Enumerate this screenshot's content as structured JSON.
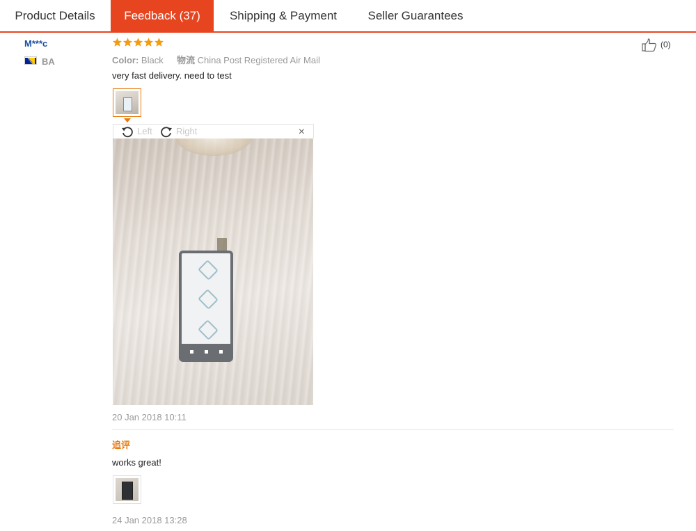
{
  "tabs": [
    {
      "label": "Product Details",
      "active": false
    },
    {
      "label": "Feedback (37)",
      "active": true
    },
    {
      "label": "Shipping & Payment",
      "active": false
    },
    {
      "label": "Seller Guarantees",
      "active": false
    }
  ],
  "accent_color": "#e64520",
  "review": {
    "buyer_name": "M***c",
    "country_code": "BA",
    "rating_stars": 5,
    "color_key": "Color:",
    "color_value": "Black",
    "logistics_key": "物流",
    "logistics_value": "China Post Registered Air Mail",
    "text": "very fast delivery. need to test",
    "viewer": {
      "rotate_left_label": "Left",
      "rotate_right_label": "Right",
      "close_label": "×"
    },
    "date": "20 Jan 2018 10:11",
    "helpful_count": "(0)"
  },
  "additional_feedback": {
    "title": "追评",
    "text": "works great!",
    "date": "24 Jan 2018 13:28"
  },
  "icons": {
    "star": "star-icon",
    "rotate_left": "rotate-left-icon",
    "rotate_right": "rotate-right-icon",
    "close": "close-icon",
    "thumbs_up": "thumbs-up-icon"
  }
}
